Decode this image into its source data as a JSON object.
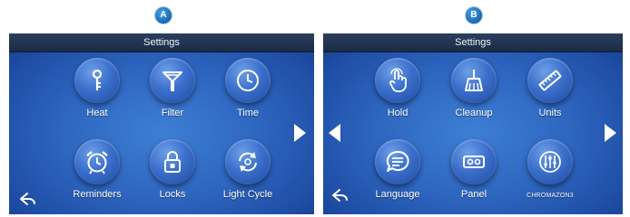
{
  "panel_a": {
    "badge": "A",
    "title": "Settings",
    "items": [
      {
        "label": "Heat",
        "icon": "thermometer-icon"
      },
      {
        "label": "Filter",
        "icon": "filter-icon"
      },
      {
        "label": "Time",
        "icon": "clock-icon"
      },
      {
        "label": "Reminders",
        "icon": "alarm-clock-icon"
      },
      {
        "label": "Locks",
        "icon": "lock-icon"
      },
      {
        "label": "Light Cycle",
        "icon": "cycle-icon"
      }
    ]
  },
  "panel_b": {
    "badge": "B",
    "title": "Settings",
    "items": [
      {
        "label": "Hold",
        "icon": "hand-icon"
      },
      {
        "label": "Cleanup",
        "icon": "broom-icon"
      },
      {
        "label": "Units",
        "icon": "ruler-icon"
      },
      {
        "label": "Language",
        "icon": "speech-bubble-icon"
      },
      {
        "label": "Panel",
        "icon": "panel-icon"
      },
      {
        "label": "CHROMAZON3",
        "icon": "chromazon3-icon"
      }
    ]
  },
  "colors": {
    "panel_center": "#3d7fd4",
    "panel_edge": "#173f8e",
    "header": "#1b2b45",
    "badge": "#1f6fb8"
  }
}
